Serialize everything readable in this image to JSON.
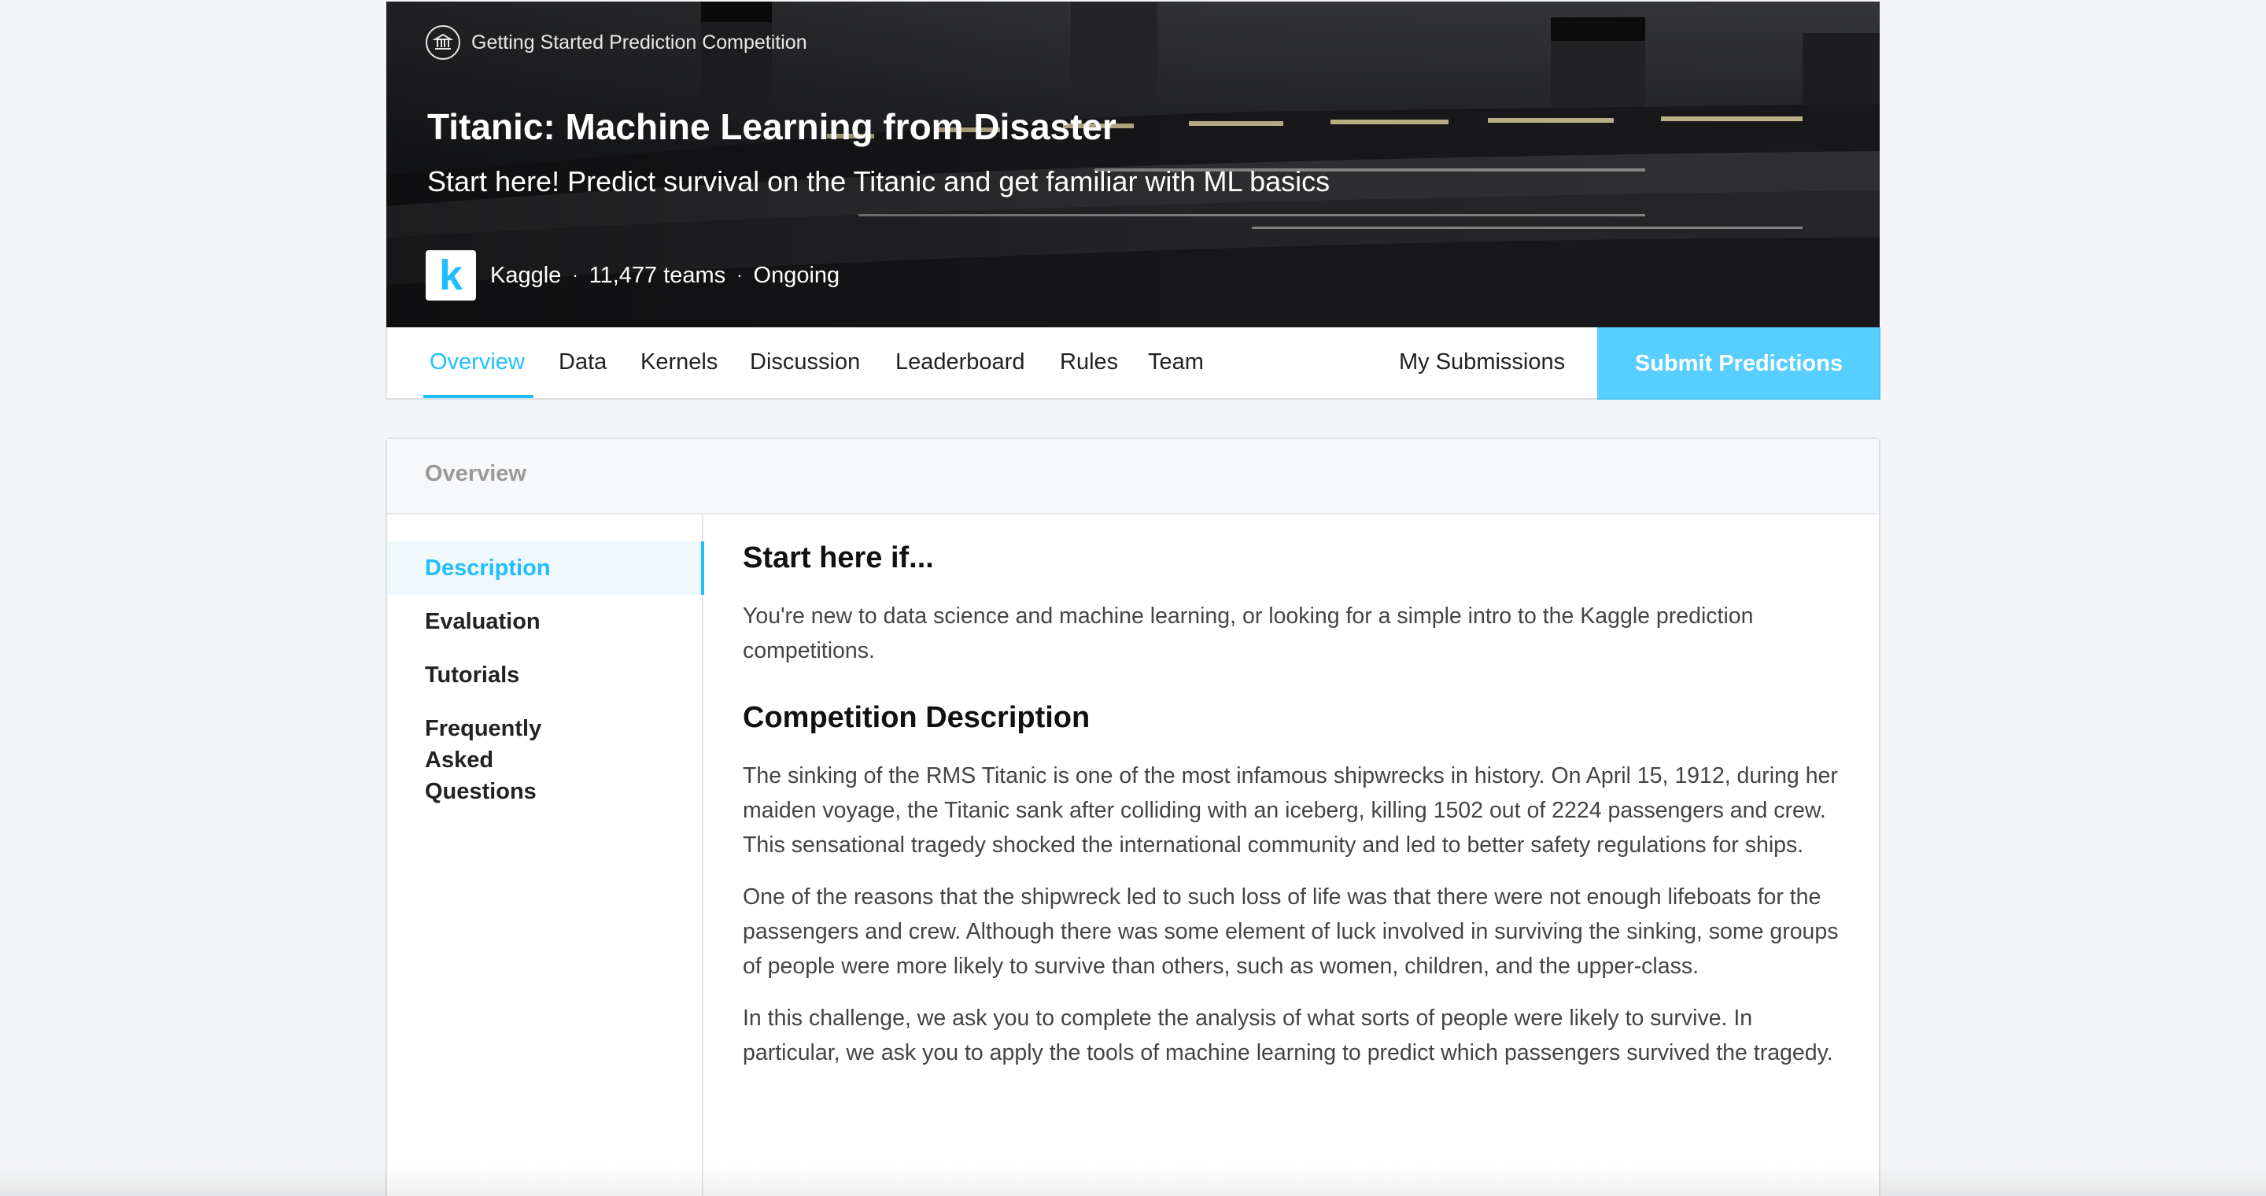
{
  "hero": {
    "badge": "Getting Started Prediction Competition",
    "title": "Titanic: Machine Learning from Disaster",
    "subtitle": "Start here! Predict survival on the Titanic and get familiar with ML basics",
    "host_logo_letter": "k",
    "host": "Kaggle",
    "teams": "11,477 teams",
    "status": "Ongoing",
    "dot": "·"
  },
  "nav": {
    "tabs": [
      {
        "label": "Overview"
      },
      {
        "label": "Data"
      },
      {
        "label": "Kernels"
      },
      {
        "label": "Discussion"
      },
      {
        "label": "Leaderboard"
      },
      {
        "label": "Rules"
      },
      {
        "label": "Team"
      }
    ],
    "my_submissions": "My Submissions",
    "submit": "Submit Predictions",
    "accent_color": "#20beff"
  },
  "card": {
    "header": "Overview",
    "side_items": [
      {
        "label": "Description"
      },
      {
        "label": "Evaluation"
      },
      {
        "label": "Tutorials"
      },
      {
        "label": "Frequently Asked Questions"
      }
    ]
  },
  "content": {
    "h1": "Start here if...",
    "p1": "You're new to data science and machine learning, or looking for a simple intro to the Kaggle prediction competitions.",
    "h2": "Competition Description",
    "p2": "The sinking of the RMS Titanic is one of the most infamous shipwrecks in history.  On April 15, 1912, during her maiden voyage, the Titanic sank after colliding with an iceberg, killing 1502 out of 2224 passengers and crew. This sensational tragedy shocked the international community and led to better safety regulations for ships.",
    "p3": "One of the reasons that the shipwreck led to such loss of life was that there were not enough lifeboats for the passengers and crew. Although there was some element of luck involved in surviving the sinking, some groups of people were more likely to survive than others, such as women, children, and the upper-class.",
    "p4": "In this challenge, we ask you to complete the analysis of what sorts of people were likely to survive. In particular, we ask you to apply the tools of machine learning to predict which passengers survived the tragedy."
  }
}
